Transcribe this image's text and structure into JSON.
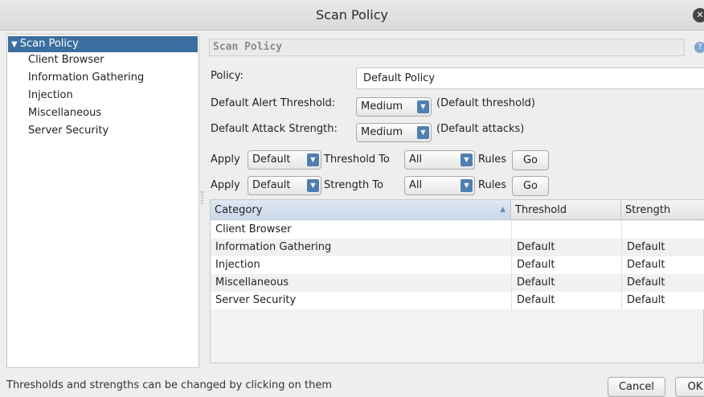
{
  "window": {
    "title": "Scan Policy"
  },
  "tree": {
    "root": "Scan Policy",
    "children": [
      "Client Browser",
      "Information Gathering",
      "Injection",
      "Miscellaneous",
      "Server Security"
    ]
  },
  "panel": {
    "header": "Scan Policy",
    "policy_label": "Policy:",
    "policy_value": "Default Policy",
    "alert_threshold_label": "Default Alert Threshold:",
    "alert_threshold_value": "Medium",
    "alert_threshold_note": "(Default threshold)",
    "attack_strength_label": "Default Attack Strength:",
    "attack_strength_value": "Medium",
    "attack_strength_note": "(Default attacks)",
    "row1": {
      "apply": "Apply",
      "level": "Default",
      "to_label": "Threshold To",
      "scope": "All",
      "rules": "Rules",
      "go": "Go"
    },
    "row2": {
      "apply": "Apply",
      "level": "Default",
      "to_label": "Strength To",
      "scope": "All",
      "rules": "Rules",
      "go": "Go"
    }
  },
  "table": {
    "columns": [
      "Category",
      "Threshold",
      "Strength"
    ],
    "rows": [
      {
        "category": "Client Browser",
        "threshold": "",
        "strength": ""
      },
      {
        "category": "Information Gathering",
        "threshold": "Default",
        "strength": "Default"
      },
      {
        "category": "Injection",
        "threshold": "Default",
        "strength": "Default"
      },
      {
        "category": "Miscellaneous",
        "threshold": "Default",
        "strength": "Default"
      },
      {
        "category": "Server Security",
        "threshold": "Default",
        "strength": "Default"
      }
    ]
  },
  "footer": {
    "status": "Thresholds and strengths can be changed by clicking on them",
    "cancel": "Cancel",
    "ok": "OK"
  },
  "colors": {
    "selection": "#3b6e9e",
    "combo_button": "#4f7fb0"
  },
  "icons": {
    "close": "close-icon",
    "help": "help-icon",
    "sort": "sort-ascending-icon",
    "expand": "expand-arrow-icon"
  }
}
